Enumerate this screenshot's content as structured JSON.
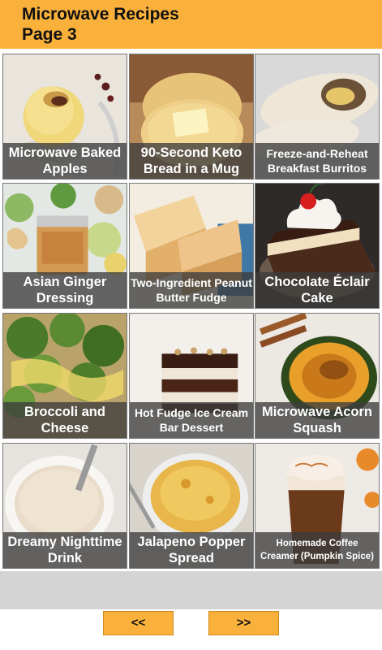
{
  "header": {
    "title_line1": "Microwave Recipes",
    "title_line2": "Page 3"
  },
  "recipes": [
    {
      "label": "Microwave Baked Apples",
      "size": "normal"
    },
    {
      "label": "90-Second Keto Bread in a Mug",
      "size": "normal"
    },
    {
      "label": "Freeze-and-Reheat Breakfast Burritos",
      "size": "small"
    },
    {
      "label": "Asian Ginger Dressing",
      "size": "normal"
    },
    {
      "label": "Two-Ingredient Peanut Butter Fudge",
      "size": "small"
    },
    {
      "label": "Chocolate Éclair Cake",
      "size": "normal"
    },
    {
      "label": "Broccoli and Cheese",
      "size": "normal"
    },
    {
      "label": "Hot Fudge Ice Cream Bar Dessert",
      "size": "small"
    },
    {
      "label": "Microwave Acorn Squash",
      "size": "normal"
    },
    {
      "label": "Dreamy Nighttime Drink",
      "size": "normal"
    },
    {
      "label": "Jalapeno Popper Spread",
      "size": "normal"
    },
    {
      "label": "Homemade Coffee Creamer (Pumpkin Spice)",
      "size": "tiny"
    }
  ],
  "nav": {
    "prev_label": "<<",
    "next_label": ">>"
  },
  "colors": {
    "header": "#f9b13c",
    "button": "#f9b13c"
  }
}
